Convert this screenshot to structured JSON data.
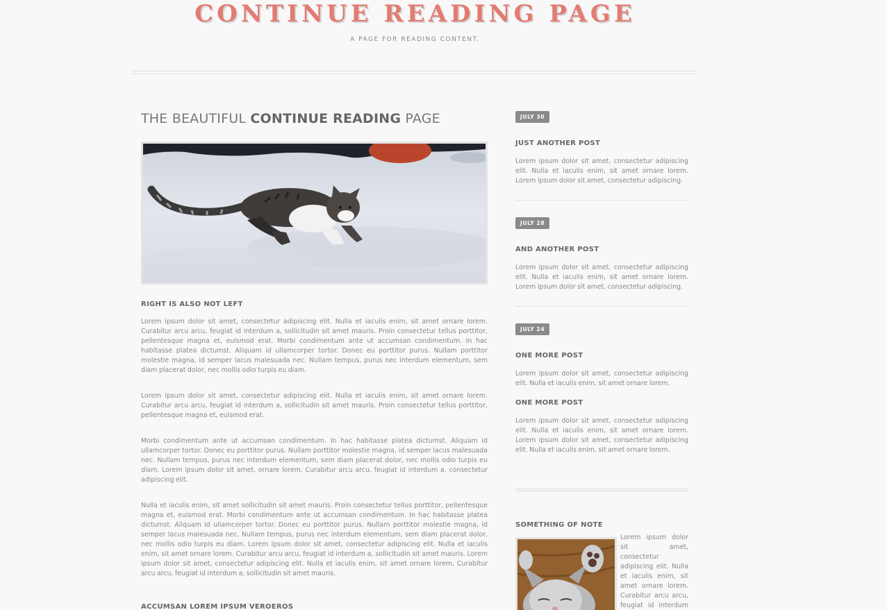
{
  "header": {
    "title": "CONTINUE READING PAGE",
    "tagline": "A PAGE FOR READING CONTENT."
  },
  "main": {
    "title_pre": "THE BEAUTIFUL ",
    "title_bold": "CONTINUE READING",
    "title_post": " PAGE",
    "hero_image": "cat-in-snow",
    "heading1": "RIGHT IS ALSO NOT LEFT",
    "paragraphs": [
      "Lorem ipsum dolor sit amet, consectetur adipiscing elit. Nulla et iaculis enim, sit amet ornare lorem. Curabitur arcu arcu, feugiat id interdum a, sollicitudin sit amet mauris. Proin consectetur tellus porttitor, pellentesque magna et, euismod erat. Morbi condimentum ante ut accumsan condimentum. In hac habitasse platea dictumst. Aliquam id ullamcorper tortor. Donec eu porttitor purus. Nullam porttitor molestie magna, id semper lacus malesuada nec. Nullam tempus, purus nec interdum elementum, sem diam placerat dolor, nec mollis odio turpis eu diam.",
      "Lorem ipsum dolor sit amet, consectetur adipiscing elit. Nulla et iaculis enim, sit amet ornare lorem. Curabitur arcu arcu, feugiat id interdum a, sollicitudin sit amet mauris. Proin consectetur tellus porttitor, pellentesque magna et, euismod erat.",
      "Morbi condimentum ante ut accumsan condimentum. In hac habitasse platea dictumst. Aliquam id ullamcorper tortor. Donec eu porttitor purus. Nullam porttitor molestie magna, id semper lacus malesuada nec. Nullam tempus, purus nec interdum elementum, sem diam placerat dolor, nec mollis odio turpis eu diam. Lorem ipsum dolor sit amet, ornare lorem. Curabitur arcu arcu, feugiat id interdum a, consectetur adipiscing elit.",
      "Nulla et iaculis enim, sit amet sollicitudin sit amet mauris. Proin consectetur tellus porttitor, pellentesque magna et, euismod erat. Morbi condimentum ante ut accumsan condimentum. In hac habitasse platea dictumst. Aliquam id ullamcorper tortor. Donec eu porttitor purus. Nullam porttitor molestie magna, id semper lacus malesuada nec. Nullam tempus, purus nec interdum elementum, sem diam placerat dolor, nec mollis odio turpis eu diam. Lorem ipsum dolor sit amet, consectetur adipiscing elit. Nulla et iaculis enim, sit amet ornare lorem. Curabitur arcu arcu, feugiat id interdum a, sollicitudin sit amet mauris. Lorem ipsum dolor sit amet, consectetur adipiscing elit. Nulla et iaculis enim, sit amet ornare lorem. Curabitur arcu arcu, feugiat id interdum a, sollicitudin sit amet mauris."
    ],
    "heading2": "ACCUMSAN LOREM IPSUM VEROEROS"
  },
  "sidebar": {
    "posts": [
      {
        "date": "JULY 30",
        "title": "JUST ANOTHER POST",
        "text": "Lorem ipsum dolor sit amet, consectetur adipiscing elit. Nulla et iaculis enim, sit amet ornare lorem. Lorem ipsum dolor sit amet, consectetur adipiscing."
      },
      {
        "date": "JULY 28",
        "title": "AND ANOTHER POST",
        "text": "Lorem ipsum dolor sit amet, consectetur adipiscing elit. Nulla et iaculis enim, sit amet ornare lorem. Lorem ipsum dolor sit amet, consectetur adipiscing."
      },
      {
        "date": "JULY 24",
        "title": "ONE MORE POST",
        "text": "Lorem ipsum dolor sit amet, consectetur adipiscing elit. Nulla et iaculis enim, sit amet ornare lorem.",
        "title2": "ONE MORE POST",
        "text2": "Lorem ipsum dolor sit amet, consectetur adipiscing elit. Nulla et iaculis enim, sit amet ornare lorem. Lorem ipsum dolor sit amet, consectetur adipiscing elit. Nulla et iaculis enim, sit amet ornare lorem."
      }
    ],
    "note": {
      "title": "SOMETHING OF NOTE",
      "image": "sleeping-kitten",
      "text": "Lorem ipsum dolor sit amet, consectetur adipiscing elit. Nulla et iaculis enim, sit amet ornare lorem. Curabitur arcu arcu, feugiat id interdum a, sollicitudin sit"
    }
  }
}
